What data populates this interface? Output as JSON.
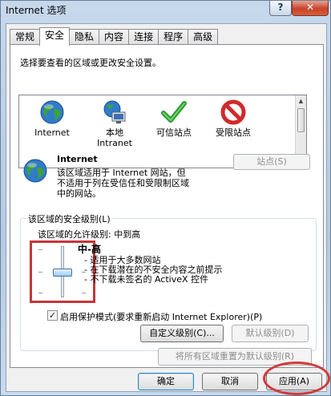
{
  "window": {
    "title": "Internet 选项",
    "help_label": "?",
    "close_label": "✕"
  },
  "tabs": [
    {
      "label": "常规"
    },
    {
      "label": "安全"
    },
    {
      "label": "隐私"
    },
    {
      "label": "内容"
    },
    {
      "label": "连接"
    },
    {
      "label": "程序"
    },
    {
      "label": "高级"
    }
  ],
  "security": {
    "instruction": "选择要查看的区域或更改安全设置。",
    "zones": [
      {
        "label": "Internet",
        "icon": "globe-icon"
      },
      {
        "label": "本地\nIntranet",
        "icon": "intranet-icon"
      },
      {
        "label": "可信站点",
        "icon": "check-icon"
      },
      {
        "label": "受限站点",
        "icon": "restricted-icon"
      }
    ],
    "selected_zone": {
      "name": "Internet",
      "desc_lines": [
        "该区域适用于 Internet 网站，但",
        "不适用于列在受信任和受限制区域",
        "中的网站。"
      ]
    },
    "sites_button": "站点(S)",
    "level_group_title": "该区域的安全级别(L)",
    "allowed_levels": "该区域的允许级别: 中到高",
    "level_name": "中-高",
    "level_bullets": [
      "- 适用于大多数网站",
      "- 在下载潜在的不安全内容之前提示",
      "- 不下载未签名的 ActiveX 控件"
    ],
    "protected_mode_label": "启用保护模式(要求重新启动 Internet Explorer)(P)",
    "protected_mode_checked": true,
    "check_mark": "✓",
    "custom_level_button": "自定义级别(C)...",
    "default_level_button": "默认级别(D)",
    "reset_all_button": "将所有区域重置为默认级别(R)"
  },
  "footer": {
    "ok": "确定",
    "cancel": "取消",
    "apply": "应用(A)"
  },
  "colors": {
    "annotation": "#d23a3a",
    "accent": "#3c7fb1"
  }
}
